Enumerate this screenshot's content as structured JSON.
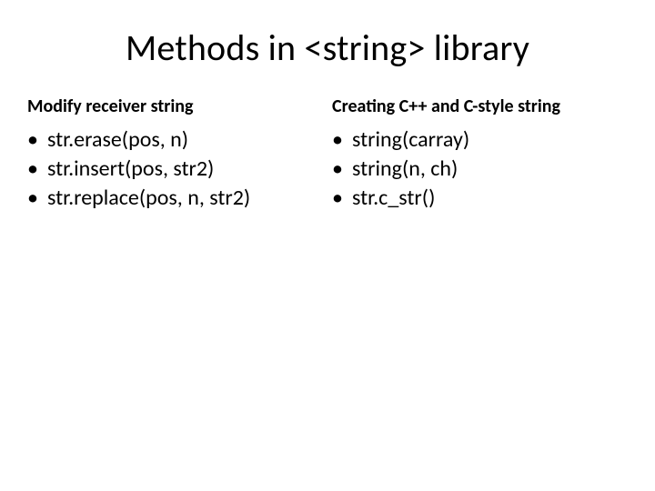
{
  "title": "Methods in <string> library",
  "left": {
    "heading": "Modify receiver string",
    "items": [
      "str.erase(pos, n)",
      "str.insert(pos, str2)",
      "str.replace(pos, n, str2)"
    ]
  },
  "right": {
    "heading": "Creating C++ and C-style string",
    "items": [
      "string(carray)",
      "string(n, ch)",
      "str.c_str()"
    ]
  }
}
